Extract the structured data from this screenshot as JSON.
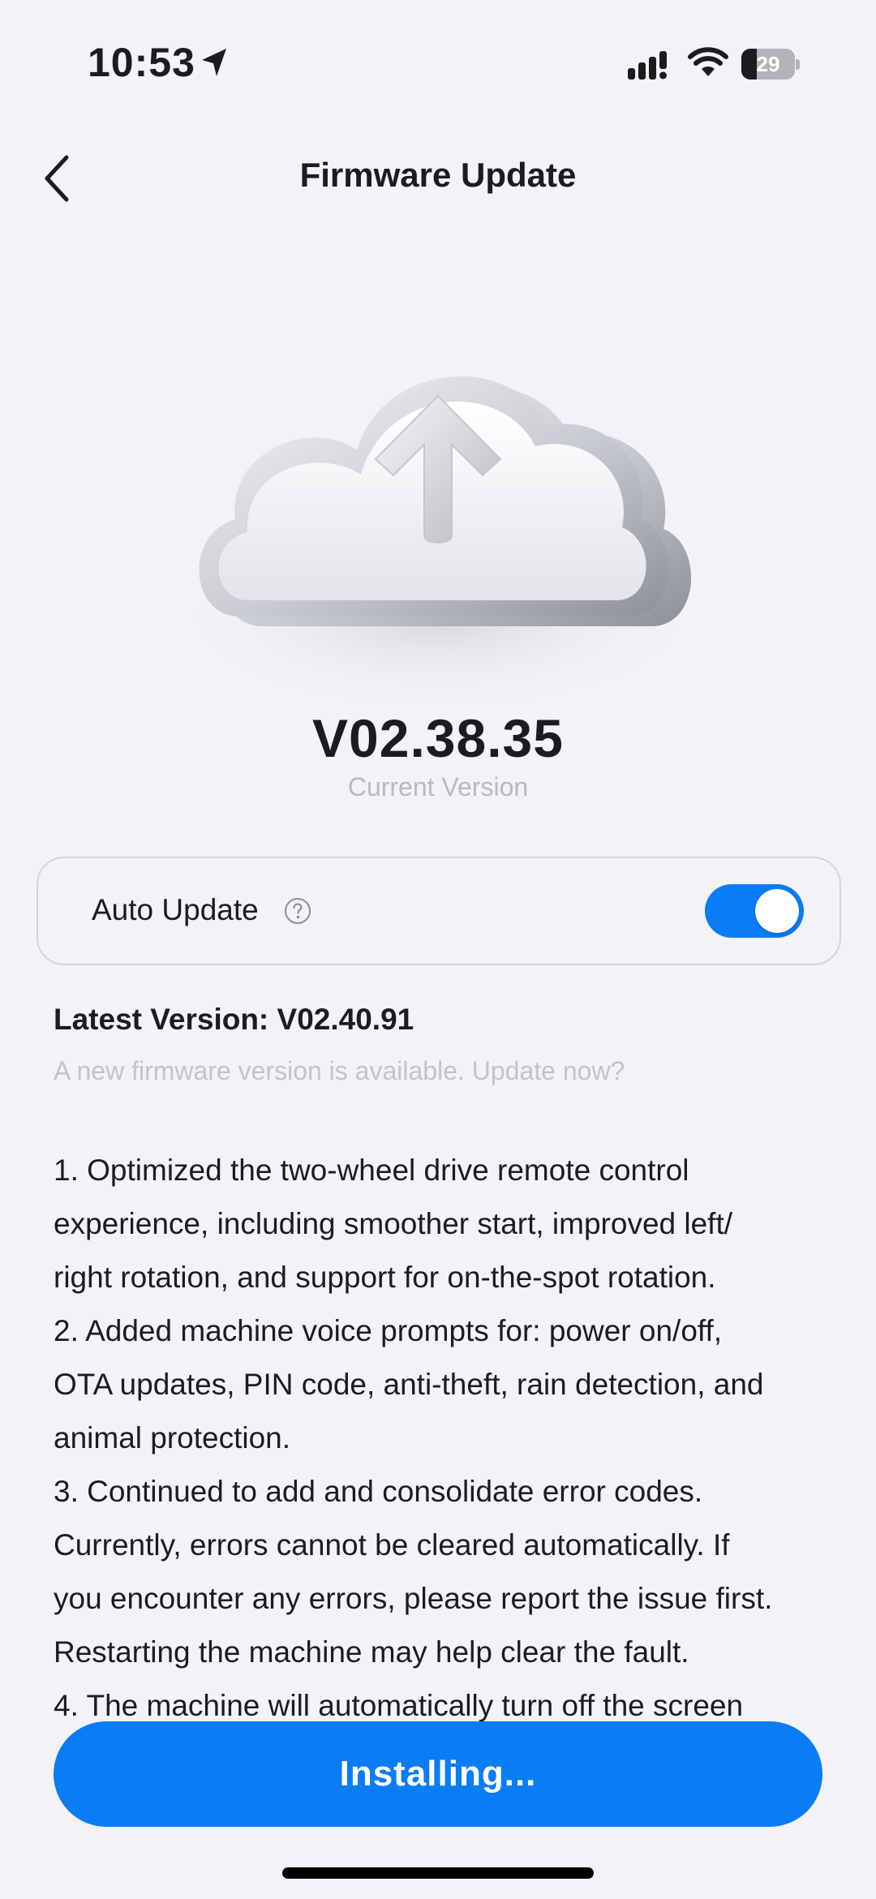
{
  "status_bar": {
    "time": "10:53",
    "battery_level": "29",
    "battery_fraction": 0.29,
    "icons": [
      "location-arrow-icon",
      "cellular-signal-icon",
      "wifi-icon",
      "battery-icon"
    ]
  },
  "nav": {
    "title": "Firmware Update",
    "back_icon": "chevron-left-icon"
  },
  "hero": {
    "image": "cloud-upload-icon",
    "version": "V02.38.35",
    "version_label": "Current Version"
  },
  "auto_update": {
    "label": "Auto Update",
    "help_icon": "question-circle-icon",
    "enabled": true
  },
  "latest": {
    "title": "Latest Version: V02.40.91",
    "subtitle": "A new firmware version is available. Update now?"
  },
  "release_notes": {
    "lines": [
      "1. Optimized the two-wheel drive remote control",
      "experience, including smoother start, improved left/",
      "right rotation, and support for on-the-spot rotation.",
      "2. Added machine voice prompts for: power on/off,",
      "OTA updates, PIN code, anti-theft, rain detection, and",
      "animal protection.",
      "3. Continued to add and consolidate error codes.",
      "Currently, errors cannot be cleared automatically. If",
      "you encounter any errors, please report the issue first.",
      "Restarting the machine may help clear the fault.",
      "4. The machine will automatically turn off the screen"
    ]
  },
  "install_button": {
    "label": "Installing..."
  },
  "colors": {
    "background": "#f2f2f7",
    "accent": "#0a7cf5",
    "text": "#1c1c1e",
    "muted": "#c3c3c8"
  }
}
